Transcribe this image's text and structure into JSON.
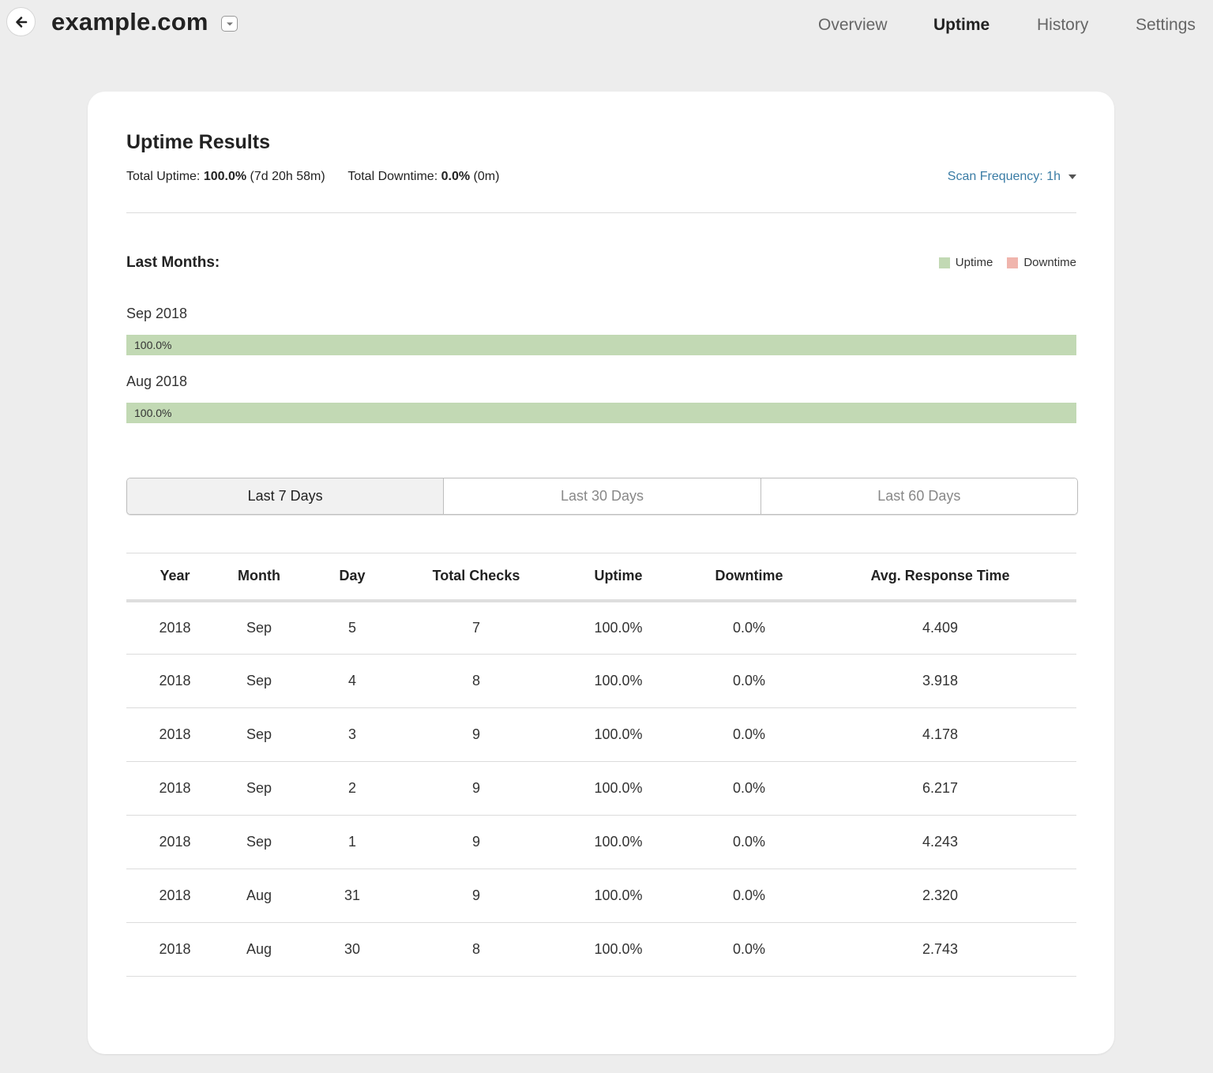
{
  "header": {
    "site_name": "example.com",
    "nav": [
      {
        "label": "Overview",
        "active": false
      },
      {
        "label": "Uptime",
        "active": true
      },
      {
        "label": "History",
        "active": false
      },
      {
        "label": "Settings",
        "active": false
      }
    ]
  },
  "summary": {
    "title": "Uptime Results",
    "uptime_label": "Total Uptime:",
    "uptime_value": "100.0%",
    "uptime_duration": "(7d 20h 58m)",
    "downtime_label": "Total Downtime:",
    "downtime_value": "0.0%",
    "downtime_duration": "(0m)",
    "scan_frequency": "Scan Frequency: 1h"
  },
  "months": {
    "title": "Last Months:",
    "legend": [
      {
        "label": "Uptime",
        "color": "#c2d9b4"
      },
      {
        "label": "Downtime",
        "color": "#f0b5ad"
      }
    ],
    "items": [
      {
        "label": "Sep 2018",
        "uptime_text": "100.0%",
        "uptime_fraction": 1.0
      },
      {
        "label": "Aug 2018",
        "uptime_text": "100.0%",
        "uptime_fraction": 1.0
      }
    ]
  },
  "range_tabs": [
    {
      "label": "Last 7 Days",
      "active": true
    },
    {
      "label": "Last 30 Days",
      "active": false
    },
    {
      "label": "Last 60 Days",
      "active": false
    }
  ],
  "table": {
    "columns": [
      "Year",
      "Month",
      "Day",
      "Total Checks",
      "Uptime",
      "Downtime",
      "Avg. Response Time"
    ],
    "rows": [
      [
        "2018",
        "Sep",
        "5",
        "7",
        "100.0%",
        "0.0%",
        "4.409"
      ],
      [
        "2018",
        "Sep",
        "4",
        "8",
        "100.0%",
        "0.0%",
        "3.918"
      ],
      [
        "2018",
        "Sep",
        "3",
        "9",
        "100.0%",
        "0.0%",
        "4.178"
      ],
      [
        "2018",
        "Sep",
        "2",
        "9",
        "100.0%",
        "0.0%",
        "6.217"
      ],
      [
        "2018",
        "Sep",
        "1",
        "9",
        "100.0%",
        "0.0%",
        "4.243"
      ],
      [
        "2018",
        "Aug",
        "31",
        "9",
        "100.0%",
        "0.0%",
        "2.320"
      ],
      [
        "2018",
        "Aug",
        "30",
        "8",
        "100.0%",
        "0.0%",
        "2.743"
      ]
    ]
  },
  "icons": {
    "back": "arrow-left-icon",
    "site_menu": "chevron-down-icon",
    "scan_caret": "caret-down-icon"
  },
  "colors": {
    "page_bg": "#ededed",
    "link": "#3a7ca5",
    "uptime_bar": "#c2d9b4",
    "downtime_bar": "#f0b5ad"
  }
}
